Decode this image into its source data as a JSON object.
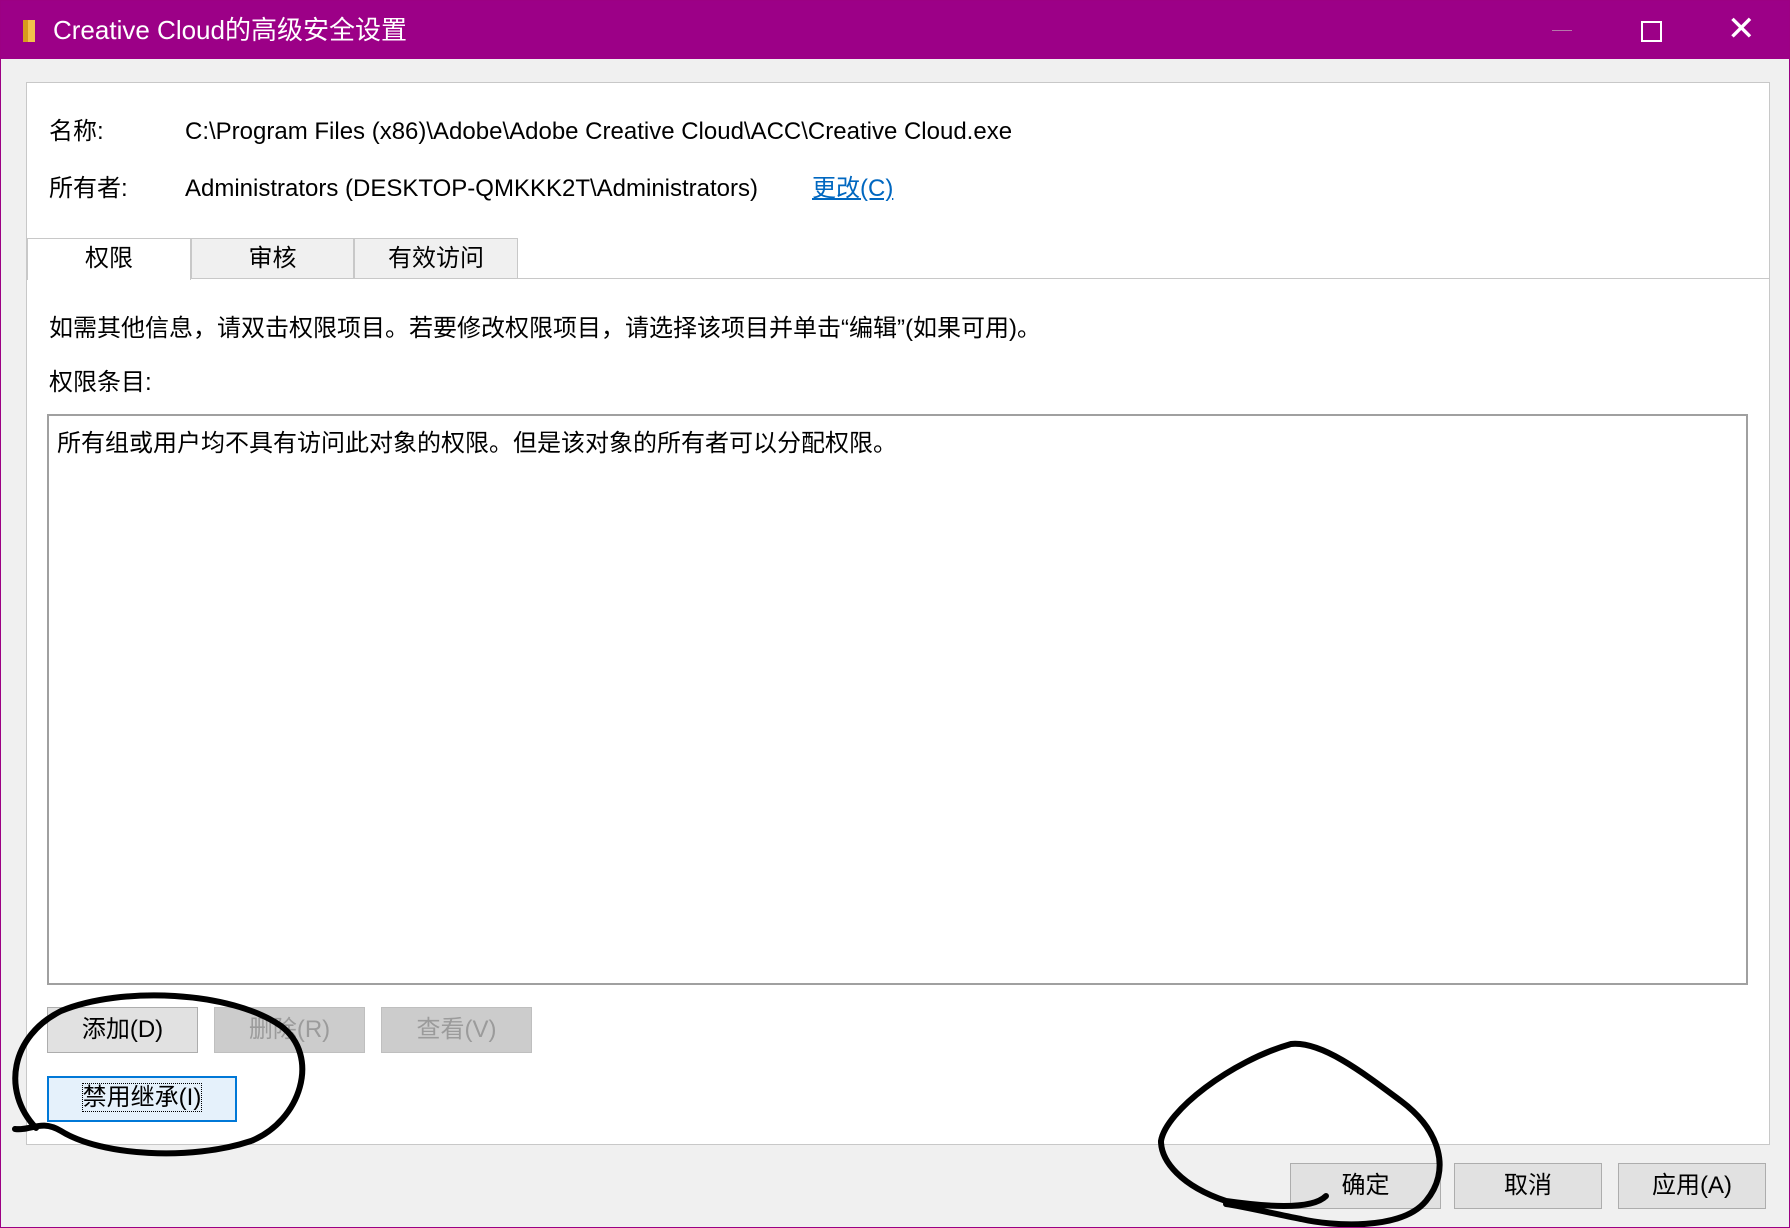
{
  "window": {
    "title": "Creative Cloud的高级安全设置",
    "accent_color": "#9c0087"
  },
  "info": {
    "name_label": "名称:",
    "name_value": "C:\\Program Files (x86)\\Adobe\\Adobe Creative Cloud\\ACC\\Creative Cloud.exe",
    "owner_label": "所有者:",
    "owner_value": "Administrators (DESKTOP-QMKKK2T\\Administrators)",
    "owner_change_link": "更改(C)"
  },
  "tabs": [
    {
      "label": "权限",
      "active": true
    },
    {
      "label": "审核",
      "active": false
    },
    {
      "label": "有效访问",
      "active": false
    }
  ],
  "permissions": {
    "hint": "如需其他信息，请双击权限项目。若要修改权限项目，请选择该项目并单击“编辑”(如果可用)。",
    "entries_label": "权限条目:",
    "empty_message": "所有组或用户均不具有访问此对象的权限。但是该对象的所有者可以分配权限。"
  },
  "entry_buttons": {
    "add": "添加(D)",
    "remove": "删除(R)",
    "view": "查看(V)",
    "disable_inheritance": "禁用继承(I)"
  },
  "dialog_buttons": {
    "ok": "确定",
    "cancel": "取消",
    "apply": "应用(A)"
  }
}
